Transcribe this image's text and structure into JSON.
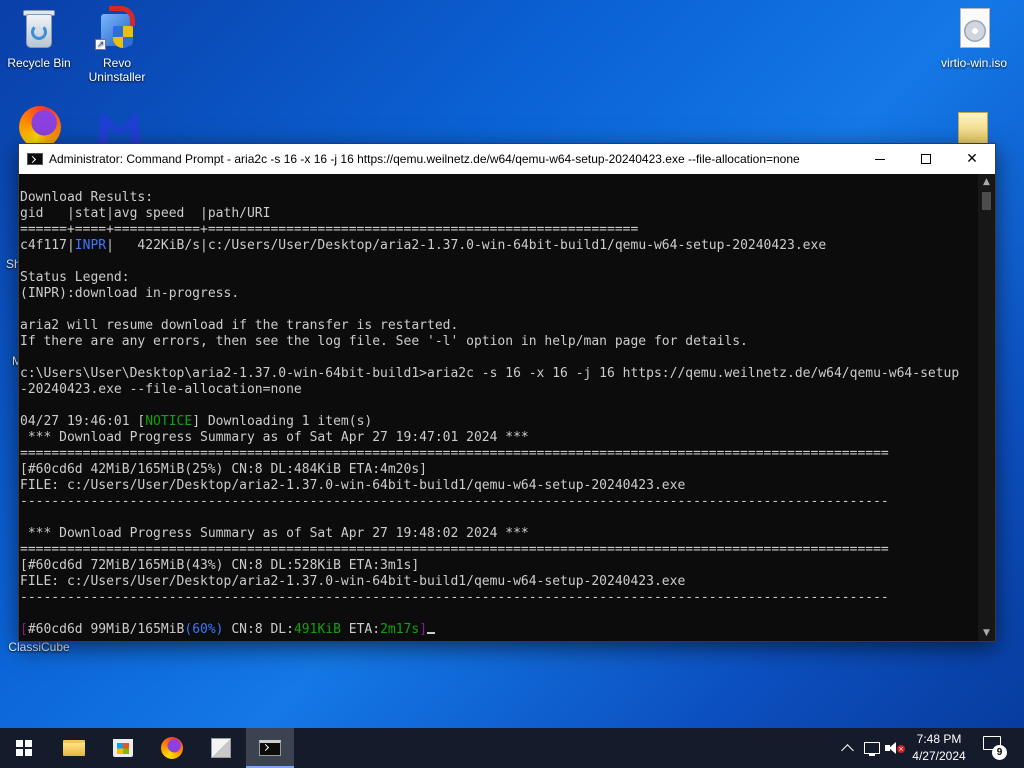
{
  "desktop": {
    "icons": [
      {
        "label": "Recycle Bin"
      },
      {
        "label": "Revo Uninstaller"
      },
      {
        "label": "virtio-win.iso"
      },
      {
        "label": "ClassiCube"
      }
    ],
    "edge_fragments": [
      "Sh",
      "M"
    ]
  },
  "window": {
    "title": "Administrator: Command Prompt - aria2c  -s 16 -x 16 -j 16 https://qemu.weilnetz.de/w64/qemu-w64-setup-20240423.exe --file-allocation=none",
    "minimize_glyph": "",
    "close_glyph": "✕"
  },
  "console": {
    "lines": [
      "Download Results:",
      "gid   |stat|avg speed  |path/URI",
      "======+====+===========+=======================================================",
      "c4f117|INPR|   422KiB/s|c:/Users/User/Desktop/aria2-1.37.0-win-64bit-build1/qemu-w64-setup-20240423.exe",
      "",
      "Status Legend:",
      "(INPR):download in-progress.",
      "",
      "aria2 will resume download if the transfer is restarted.",
      "If there are any errors, then see the log file. See '-l' option in help/man page for details.",
      "",
      "c:\\Users\\User\\Desktop\\aria2-1.37.0-win-64bit-build1>aria2c -s 16 -x 16 -j 16 https://qemu.weilnetz.de/w64/qemu-w64-setup",
      "-20240423.exe --file-allocation=none",
      "",
      "04/27 19:46:01 [NOTICE] Downloading 1 item(s)",
      " *** Download Progress Summary as of Sat Apr 27 19:47:01 2024 ***",
      "===============================================================================================================",
      "[#60cd6d 42MiB/165MiB(25%) CN:8 DL:484KiB ETA:4m20s]",
      "FILE: c:/Users/User/Desktop/aria2-1.37.0-win-64bit-build1/qemu-w64-setup-20240423.exe",
      "---------------------------------------------------------------------------------------------------------------",
      "",
      " *** Download Progress Summary as of Sat Apr 27 19:48:02 2024 ***",
      "===============================================================================================================",
      "[#60cd6d 72MiB/165MiB(43%) CN:8 DL:528KiB ETA:3m1s]",
      "FILE: c:/Users/User/Desktop/aria2-1.37.0-win-64bit-build1/qemu-w64-setup-20240423.exe",
      "---------------------------------------------------------------------------------------------------------------",
      ""
    ],
    "inpr_row": {
      "gid": "c4f117",
      "stat": "INPR",
      "speed": "   422KiB/s",
      "path": "c:/Users/User/Desktop/aria2-1.37.0-win-64bit-build1/qemu-w64-setup-20240423.exe"
    },
    "notice_row": {
      "time": "04/27 19:46:01 ",
      "tag": "NOTICE",
      "msg": " Downloading 1 item(s)"
    },
    "live_row": {
      "id": "#60cd6d ",
      "size": "99MiB/165MiB",
      "pct": "(60%)",
      "cn": " CN:8 DL:",
      "dl": "491KiB",
      "eta_label": " ETA:",
      "eta": "2m17s"
    }
  },
  "taskbar": {
    "time": "7:48 PM",
    "date": "4/27/2024",
    "notification_count": "9"
  },
  "colors": {
    "console_bg": "#0c0c0c",
    "console_fg": "#cccccc",
    "accent_blue": "#3b78ff",
    "accent_green": "#13a10e",
    "accent_purple": "#881798",
    "taskbar_bg": "#141c2b"
  },
  "icons": [
    "recycle-bin-icon",
    "revo-uninstaller-icon",
    "firefox-icon",
    "malwarebytes-icon",
    "iso-file-icon",
    "folder-icon",
    "classicube-icon",
    "windows-start-icon",
    "file-explorer-icon",
    "microsoft-store-icon",
    "cube-app-icon",
    "command-prompt-icon",
    "network-icon",
    "volume-muted-icon",
    "notification-icon"
  ]
}
